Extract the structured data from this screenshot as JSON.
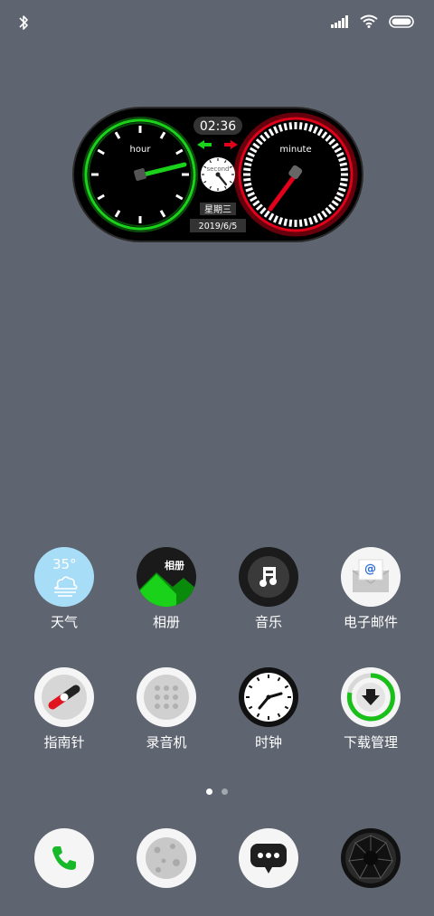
{
  "colors": {
    "wallpaper": "#5f6570",
    "hour_accent": "#19d219",
    "minute_accent": "#e3001b",
    "widget_bg": "#000000"
  },
  "status_bar": {
    "left_icons": [
      "bluetooth-icon"
    ],
    "right_icons": [
      "signal-icon",
      "wifi-icon",
      "battery-icon"
    ]
  },
  "clock_widget": {
    "time": "02:36",
    "hour_label": "hour",
    "minute_label": "minute",
    "second_label": "second",
    "weekday": "星期三",
    "date": "2019/6/5",
    "arrows": [
      "left-arrow-green-icon",
      "right-arrow-red-icon"
    ]
  },
  "apps": [
    {
      "name": "weather",
      "label": "天气",
      "temp": "35°"
    },
    {
      "name": "album",
      "label": "相册",
      "icon_text": "相册"
    },
    {
      "name": "music",
      "label": "音乐"
    },
    {
      "name": "email",
      "label": "电子邮件",
      "icon_text": "@"
    },
    {
      "name": "compass",
      "label": "指南针"
    },
    {
      "name": "recorder",
      "label": "录音机"
    },
    {
      "name": "clock",
      "label": "时钟"
    },
    {
      "name": "download",
      "label": "下载管理"
    }
  ],
  "page_indicator": {
    "count": 2,
    "active": 0
  },
  "dock": [
    {
      "name": "phone",
      "icon": "phone-icon"
    },
    {
      "name": "contacts",
      "icon": "contacts-icon"
    },
    {
      "name": "messages",
      "icon": "message-icon"
    },
    {
      "name": "camera",
      "icon": "camera-icon"
    }
  ]
}
